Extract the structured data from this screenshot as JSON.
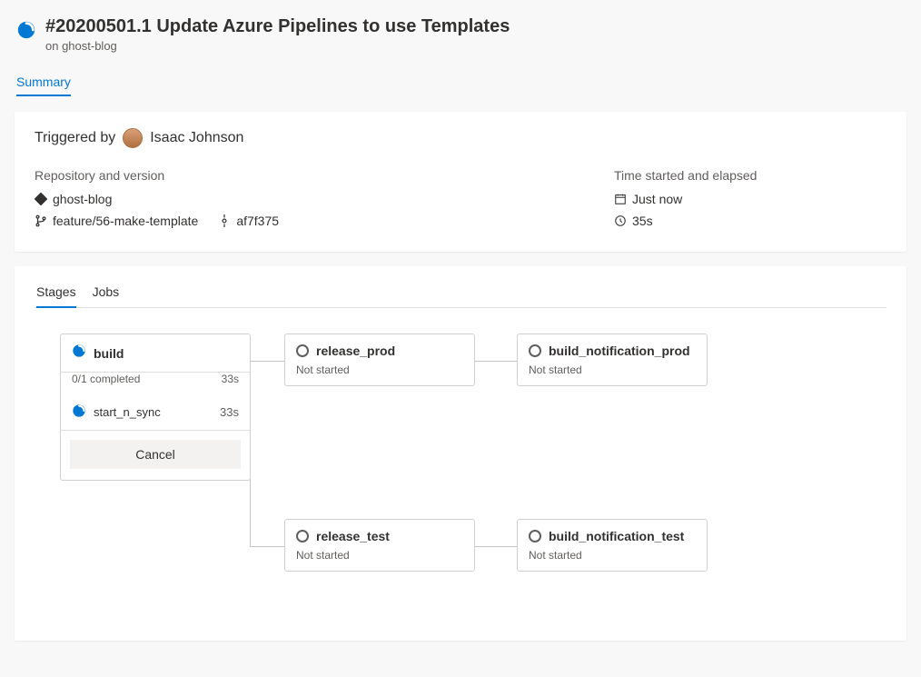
{
  "header": {
    "title": "#20200501.1 Update Azure Pipelines to use Templates",
    "subline": "on ghost-blog"
  },
  "tabs": {
    "summary": "Summary"
  },
  "triggered": {
    "label": "Triggered by",
    "user": "Isaac Johnson"
  },
  "repo": {
    "label": "Repository and version",
    "name": "ghost-blog",
    "branch": "feature/56-make-template",
    "commit": "af7f375"
  },
  "time": {
    "label": "Time started and elapsed",
    "started": "Just now",
    "elapsed": "35s"
  },
  "inner_tabs": {
    "stages": "Stages",
    "jobs": "Jobs"
  },
  "stages": {
    "build": {
      "name": "build",
      "progress": "0/1 completed",
      "duration": "33s",
      "jobs": [
        {
          "name": "start_n_sync",
          "duration": "33s"
        }
      ],
      "cancel": "Cancel"
    },
    "release_prod": {
      "name": "release_prod",
      "status": "Not started"
    },
    "build_notification_prod": {
      "name": "build_notification_prod",
      "status": "Not started"
    },
    "release_test": {
      "name": "release_test",
      "status": "Not started"
    },
    "build_notification_test": {
      "name": "build_notification_test",
      "status": "Not started"
    }
  }
}
